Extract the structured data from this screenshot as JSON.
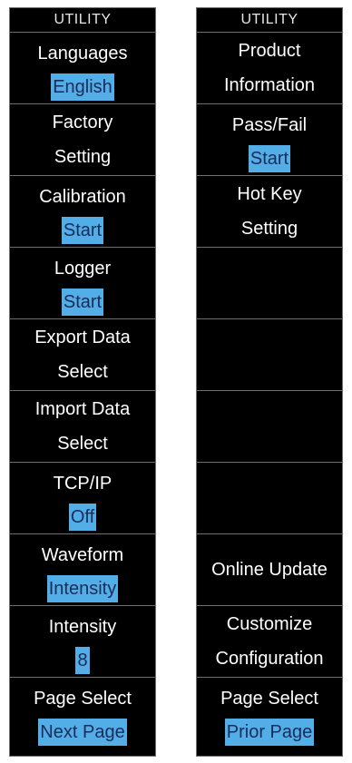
{
  "left_menu": {
    "title": "UTILITY",
    "items": [
      {
        "label": "Languages",
        "value": "English"
      },
      {
        "label": "Factory",
        "line2": "Setting"
      },
      {
        "label": "Calibration",
        "value": "Start"
      },
      {
        "label": "Logger",
        "value": "Start"
      },
      {
        "label": "Export Data",
        "line2": "Select"
      },
      {
        "label": "Import Data",
        "line2": "Select"
      },
      {
        "label": "TCP/IP",
        "value": "Off"
      },
      {
        "label": "Waveform",
        "value": "Intensity"
      },
      {
        "label": "Intensity",
        "value": "8"
      },
      {
        "label": "Page Select",
        "value": "Next Page"
      }
    ]
  },
  "right_menu": {
    "title": "UTILITY",
    "items": [
      {
        "label": "Product",
        "line2": "Information"
      },
      {
        "label": "Pass/Fail",
        "value": "Start"
      },
      {
        "label": "Hot Key",
        "line2": "Setting"
      },
      {},
      {},
      {},
      {},
      {
        "label": "Online Update"
      },
      {
        "label": "Customize",
        "line2": "Configuration"
      },
      {
        "label": "Page Select",
        "value": "Prior Page"
      }
    ]
  },
  "colors": {
    "panel_background": "#000000",
    "divider": "#6e6e6e",
    "text": "#ffffff",
    "value_highlight": "#53aee8",
    "value_text": "#1a2c57"
  }
}
